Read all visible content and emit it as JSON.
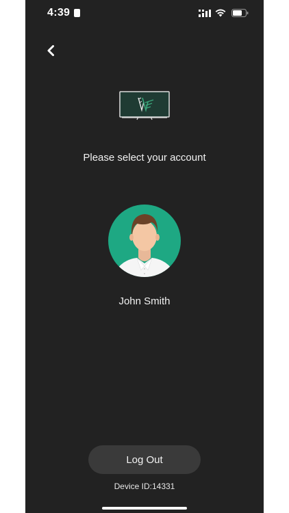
{
  "status_bar": {
    "time": "4:39",
    "icons": [
      "id-badge-icon",
      "signal-icon",
      "wifi-icon",
      "battery-icon"
    ]
  },
  "nav": {
    "back_icon": "chevron-left-icon"
  },
  "logo": {
    "icon": "tv-logo-icon",
    "accent_color": "#3aa57a"
  },
  "prompt": "Please select your account",
  "account": {
    "name": "John Smith",
    "avatar_icon": "user-avatar-icon",
    "avatar_color": "#1ea883"
  },
  "logout_label": "Log Out",
  "device_id": "Device ID:14331",
  "colors": {
    "background": "#222222",
    "button": "#3a3a3a"
  }
}
